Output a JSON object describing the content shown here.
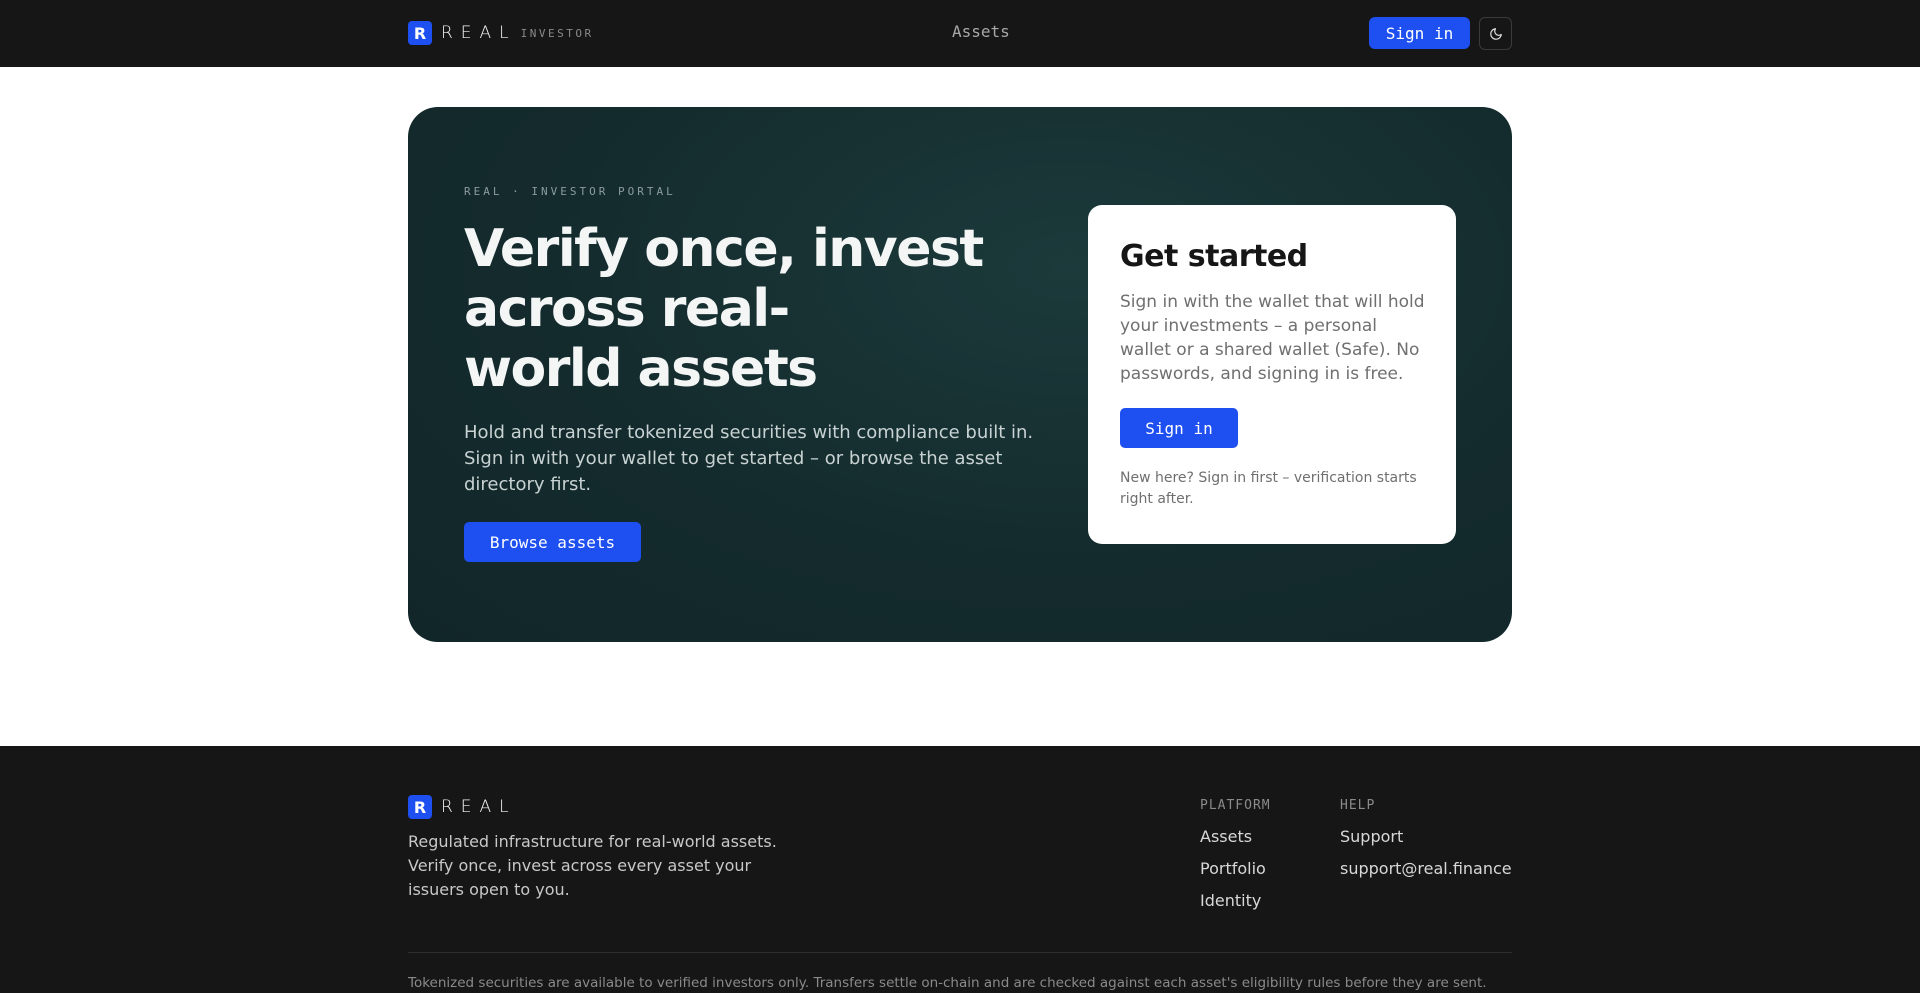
{
  "header": {
    "logo_mark": "R",
    "logo_word": "REAL",
    "logo_sub": "INVESTOR",
    "nav_assets": "Assets",
    "signin_label": "Sign in",
    "theme_icon": "moon-icon"
  },
  "hero": {
    "eyebrow": "REAL · INVESTOR PORTAL",
    "headline_line1": "Verify once, invest",
    "headline_line2": "across real-",
    "headline_line3": "world assets",
    "description": "Hold and transfer tokenized securities with compliance built in. Sign in with your wallet to get started – or browse the asset directory first.",
    "browse_label": "Browse assets"
  },
  "card": {
    "title": "Get started",
    "description": "Sign in with the wallet that will hold your investments – a personal wallet or a shared wallet (Safe). No passwords, and signing in is free.",
    "signin_label": "Sign in",
    "note": "New here? Sign in first – verification starts right after."
  },
  "footer": {
    "logo_mark": "R",
    "logo_word": "REAL",
    "tagline": "Regulated infrastructure for real-world assets. Verify once, invest across every asset your issuers open to you.",
    "platform_heading": "PLATFORM",
    "platform_links": [
      "Assets",
      "Portfolio",
      "Identity"
    ],
    "help_heading": "HELP",
    "help_links": [
      "Support",
      "support@real.finance"
    ],
    "disclaimer": "Tokenized securities are available to verified investors only. Transfers settle on-chain and are checked against each asset's eligibility rules before they are sent."
  },
  "colors": {
    "accent": "#1e4ff0",
    "nav_bg": "#161616",
    "hero_bg": "#142b2d"
  }
}
